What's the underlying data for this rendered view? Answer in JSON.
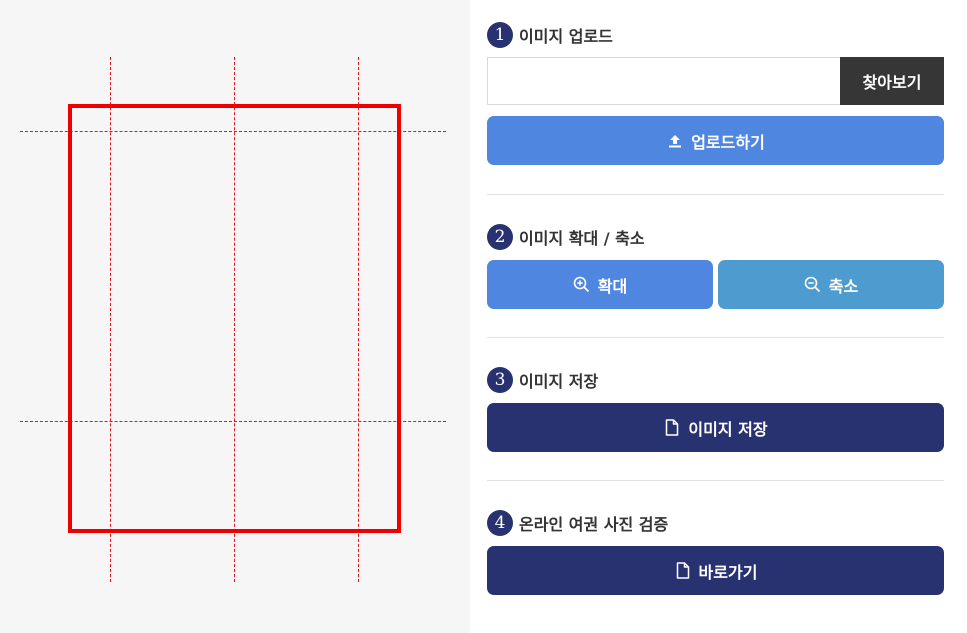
{
  "steps": {
    "upload": {
      "number": "1",
      "title": "이미지 업로드",
      "file_value": "",
      "browse_label": "찾아보기",
      "upload_label": "업로드하기"
    },
    "zoom": {
      "number": "2",
      "title": "이미지 확대 / 축소",
      "zoom_in_label": "확대",
      "zoom_out_label": "축소"
    },
    "save": {
      "number": "3",
      "title": "이미지 저장",
      "save_label": "이미지 저장"
    },
    "verify": {
      "number": "4",
      "title": "온라인 여권 사진 검증",
      "go_label": "바로가기"
    }
  },
  "colors": {
    "accent_navy": "#283270",
    "button_blue": "#4f86e0",
    "button_steel": "#4e9ccf",
    "browse_dark": "#363636",
    "guide_red": "#e0141b",
    "frame_red": "#ee0000"
  },
  "icons": {
    "upload": "upload-icon",
    "zoom_in": "zoom-in-icon",
    "zoom_out": "zoom-out-icon",
    "file": "file-icon"
  }
}
